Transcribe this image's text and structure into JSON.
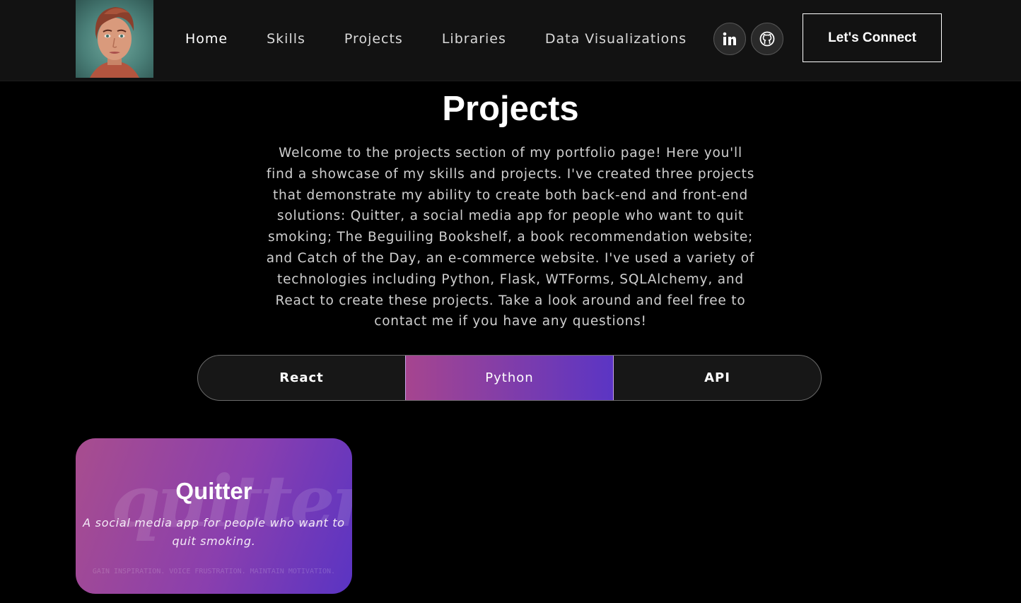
{
  "nav": {
    "links": [
      {
        "label": "Home"
      },
      {
        "label": "Skills"
      },
      {
        "label": "Projects"
      },
      {
        "label": "Libraries"
      },
      {
        "label": "Data Visualizations"
      }
    ],
    "social": [
      {
        "icon": "linkedin-icon"
      },
      {
        "icon": "github-icon"
      }
    ],
    "connect_label": "Let's Connect"
  },
  "section": {
    "title": "Projects",
    "intro": "Welcome to the projects section of my portfolio page! Here you'll find a showcase of my skills and projects. I've created three projects that demonstrate my ability to create both back-end and front-end solutions: Quitter, a social media app for people who want to quit smoking; The Beguiling Bookshelf, a book recommendation website; and Catch of the Day, an e-commerce website. I've used a variety of technologies including Python, Flask, WTForms, SQLAlchemy, and React to create these projects. Take a look around and feel free to contact me if you have any questions!"
  },
  "tabs": [
    {
      "label": "React"
    },
    {
      "label": "Python"
    },
    {
      "label": "API"
    }
  ],
  "active_tab": "Python",
  "projects": [
    {
      "watermark": "quitter",
      "title": "Quitter",
      "description": "A social media app for people who want to quit smoking.",
      "tagline": "GAIN INSPIRATION. VOICE FRUSTRATION. MAINTAIN MOTIVATION."
    }
  ],
  "colors": {
    "background": "#000000",
    "navbar": "#121212",
    "accent_start": "#a6458f",
    "accent_end": "#5b35c4"
  }
}
